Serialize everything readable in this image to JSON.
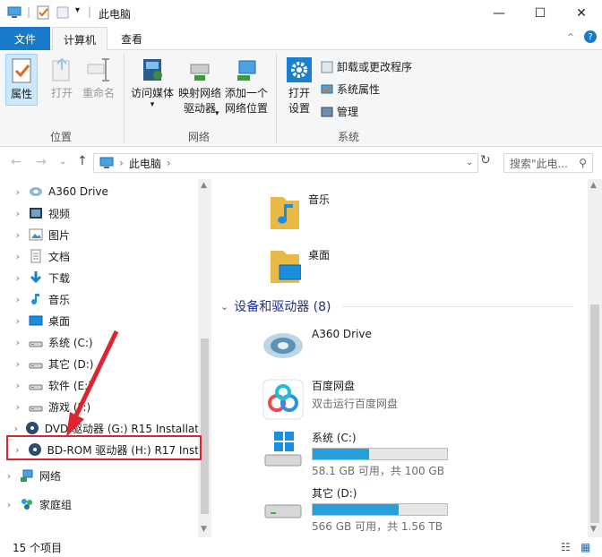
{
  "window": {
    "title": "此电脑",
    "minimize": "—",
    "maximize": "☐",
    "close": "✕"
  },
  "tabs": {
    "file": "文件",
    "computer": "计算机",
    "view": "查看"
  },
  "ribbon": {
    "properties": "属性",
    "open": "打开",
    "rename": "重命名",
    "access_media": "访问媒体",
    "map_drive_line1": "映射网络",
    "map_drive_line2": "驱动器",
    "add_network_line1": "添加一个",
    "add_network_line2": "网络位置",
    "open_settings_line1": "打开",
    "open_settings_line2": "设置",
    "uninstall": "卸载或更改程序",
    "system_properties": "系统属性",
    "manage": "管理",
    "group_location": "位置",
    "group_network": "网络",
    "group_system": "系统"
  },
  "address": {
    "path": "此电脑",
    "search_placeholder": "搜索\"此电..."
  },
  "nav": {
    "items": [
      {
        "label": "A360 Drive",
        "icon": "a360-icon"
      },
      {
        "label": "视频",
        "icon": "video-folder-icon"
      },
      {
        "label": "图片",
        "icon": "pictures-folder-icon"
      },
      {
        "label": "文档",
        "icon": "documents-folder-icon"
      },
      {
        "label": "下载",
        "icon": "downloads-folder-icon"
      },
      {
        "label": "音乐",
        "icon": "music-folder-icon"
      },
      {
        "label": "桌面",
        "icon": "desktop-folder-icon"
      },
      {
        "label": "系统 (C:)",
        "icon": "drive-icon"
      },
      {
        "label": "其它 (D:)",
        "icon": "drive-icon"
      },
      {
        "label": "软件 (E:)",
        "icon": "drive-icon"
      },
      {
        "label": "游戏 (F:)",
        "icon": "drive-icon"
      },
      {
        "label": "DVD 驱动器 (G:) R15 Installat",
        "icon": "dvd-drive-icon"
      },
      {
        "label": "BD-ROM 驱动器 (H:) R17 Inst",
        "icon": "bd-rom-drive-icon"
      },
      {
        "label": "网络",
        "icon": "network-icon"
      },
      {
        "label": "家庭组",
        "icon": "homegroup-icon"
      }
    ]
  },
  "content": {
    "folders": [
      {
        "label": "音乐"
      },
      {
        "label": "桌面"
      }
    ],
    "group_header": "设备和驱动器 (8)",
    "a360": {
      "label": "A360 Drive"
    },
    "baidu": {
      "label": "百度网盘",
      "sub": "双击运行百度网盘"
    },
    "drives": [
      {
        "label": "系统 (C:)",
        "info": "58.1 GB 可用，共 100 GB",
        "used_fraction": 0.42
      },
      {
        "label": "其它 (D:)",
        "info": "566 GB 可用，共 1.56 TB",
        "used_fraction": 0.64
      }
    ]
  },
  "status": {
    "count": "15 个项目"
  },
  "colors": {
    "accent": "#1979ca",
    "drive_fill": "#26a0da",
    "highlight": "#e0232c",
    "group_header": "#1e3287"
  }
}
